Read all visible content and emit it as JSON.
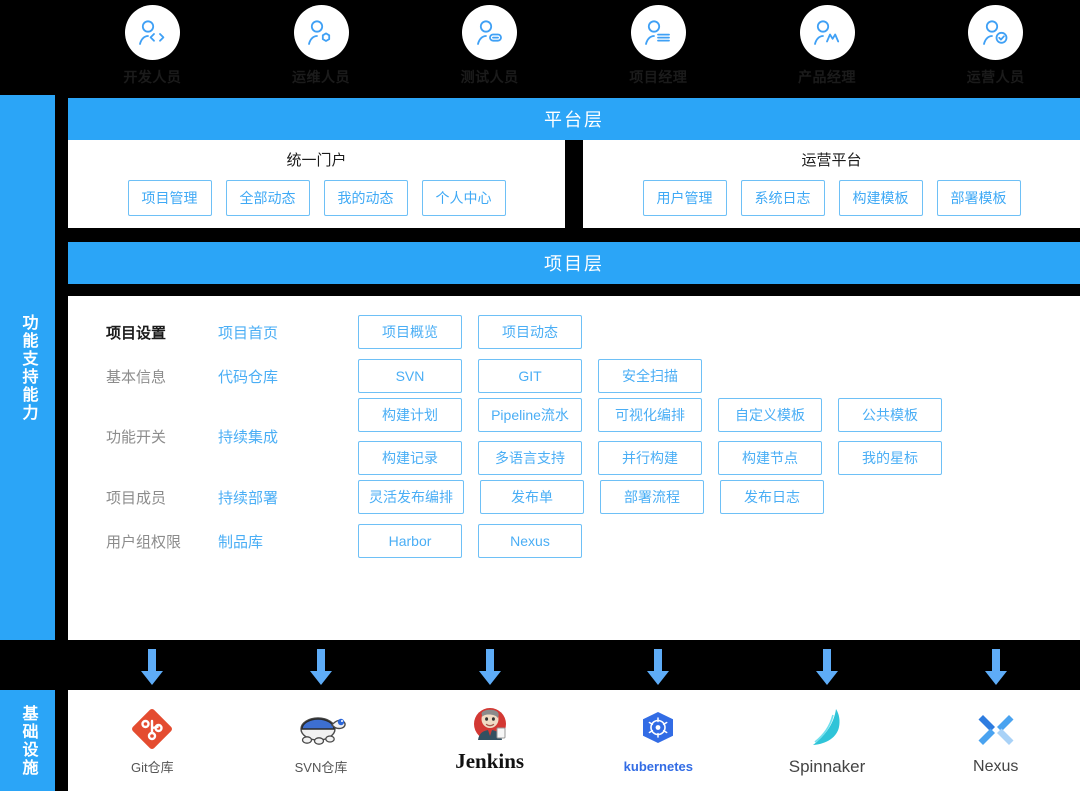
{
  "roles": [
    {
      "label": "开发人员",
      "icon": "user-code-icon"
    },
    {
      "label": "运维人员",
      "icon": "user-gear-icon"
    },
    {
      "label": "测试人员",
      "icon": "user-bug-icon"
    },
    {
      "label": "项目经理",
      "icon": "user-list-icon"
    },
    {
      "label": "产品经理",
      "icon": "user-chart-icon"
    },
    {
      "label": "运营人员",
      "icon": "user-check-icon"
    }
  ],
  "rails": {
    "capability": "功能支持能力",
    "infrastructure": "基础设施"
  },
  "platform": {
    "title": "平台层",
    "panels": [
      {
        "title": "统一门户",
        "items": [
          "项目管理",
          "全部动态",
          "我的动态",
          "个人中心"
        ]
      },
      {
        "title": "运营平台",
        "items": [
          "用户管理",
          "系统日志",
          "构建模板",
          "部署模板"
        ]
      }
    ]
  },
  "project": {
    "title": "项目层",
    "rows": [
      {
        "left": "项目设置",
        "left_strong": true,
        "middle": "项目首页",
        "lines": [
          [
            "项目概览",
            "项目动态"
          ]
        ]
      },
      {
        "left": "基本信息",
        "left_strong": false,
        "middle": "代码仓库",
        "lines": [
          [
            "SVN",
            "GIT",
            "安全扫描"
          ]
        ]
      },
      {
        "left": "功能开关",
        "left_strong": false,
        "middle": "持续集成",
        "lines": [
          [
            "构建计划",
            "Pipeline流水",
            "可视化编排",
            "自定义模板",
            "公共模板"
          ],
          [
            "构建记录",
            "多语言支持",
            "并行构建",
            "构建节点",
            "我的星标"
          ]
        ]
      },
      {
        "left": "项目成员",
        "left_strong": false,
        "middle": "持续部署",
        "lines": [
          [
            "灵活发布编排",
            "发布单",
            "部署流程",
            "发布日志"
          ]
        ]
      },
      {
        "left": "用户组权限",
        "left_strong": false,
        "middle": "制品库",
        "lines": [
          [
            "Harbor",
            "Nexus"
          ]
        ]
      }
    ]
  },
  "arrows": {
    "count": 6,
    "direction": "down",
    "icon": "arrow-down-icon"
  },
  "infrastructure": [
    {
      "label": "Git仓库",
      "icon": "git-logo",
      "style": ""
    },
    {
      "label": "SVN仓库",
      "icon": "tortoise-svn-logo",
      "style": ""
    },
    {
      "label": "Jenkins",
      "icon": "jenkins-logo",
      "style": "jenkins"
    },
    {
      "label": "kubernetes",
      "icon": "kubernetes-logo",
      "style": "k8s"
    },
    {
      "label": "Spinnaker",
      "icon": "spinnaker-logo",
      "style": "spin"
    },
    {
      "label": "Nexus",
      "icon": "nexus-logo",
      "style": "nexus"
    }
  ],
  "colors": {
    "accent_blue": "#2BA5F7",
    "chip_blue": "#4AAEF5",
    "chip_border": "#6EC0F6",
    "background": "#000000",
    "panel": "#FFFFFF"
  }
}
